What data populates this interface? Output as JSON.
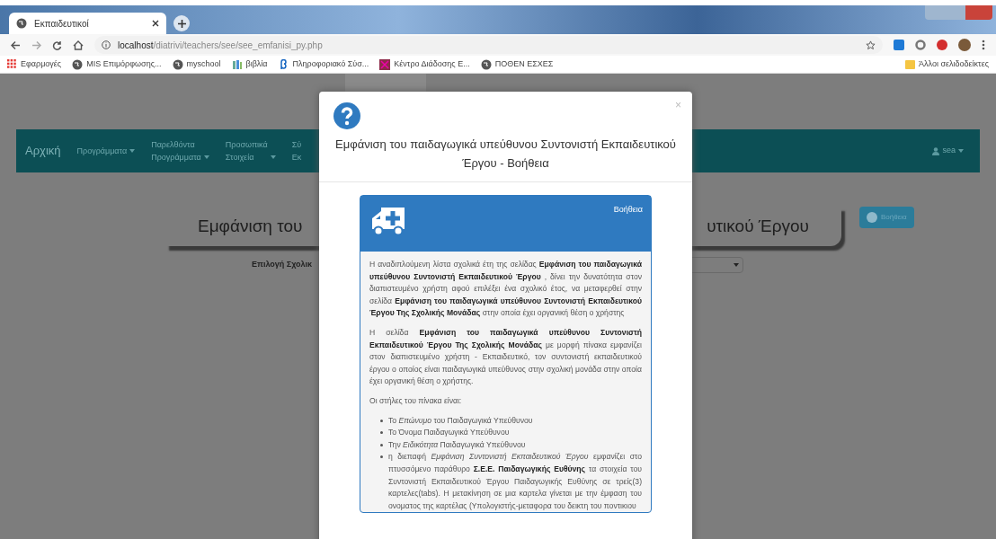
{
  "browser": {
    "tab": {
      "title": "Εκπαιδευτικοί",
      "selected": true
    },
    "url_host": "localhost",
    "url_path": "/diatrivi/teachers/see/see_emfanisi_py.php",
    "bookmarks": [
      {
        "kind": "apps",
        "label": "Εφαρμογές"
      },
      {
        "kind": "globe",
        "label": "MIS Επιμόρφωσης..."
      },
      {
        "kind": "globe",
        "label": "myschool"
      },
      {
        "kind": "books",
        "label": "βιβλία"
      },
      {
        "kind": "beta",
        "label": "Πληροφοριακό Σύσ..."
      },
      {
        "kind": "square",
        "label": "Κέντρο Διάδοσης Ε..."
      },
      {
        "kind": "globe",
        "label": "ΠΟΘΕΝ ΕΣΧΕΣ"
      }
    ],
    "other_bookmarks": "Άλλοι σελιδοδείκτες"
  },
  "navbar": {
    "brand": "Αρχική",
    "menus": [
      {
        "label": "Προγράμματα",
        "dropdown": true
      },
      {
        "label": "Παρελθόντα",
        "second": "Προγράμματα",
        "dropdown": true
      },
      {
        "label": "Προσωπικά",
        "second": "Στοιχεία",
        "dropdown": true
      },
      {
        "label": "Σύ",
        "second": "Εκ",
        "dropdown": false
      }
    ],
    "user": "sea"
  },
  "page": {
    "title_left": "Εμφάνιση του",
    "title_right": "υτικού Έργου",
    "school_year_label": "Επιλογή Σχολικ",
    "help_button": "Βοήθεια"
  },
  "modal": {
    "title": "Εμφάνιση του παιδαγωγικά υπεύθυνου Συντονιστή Εκπαιδευτικού Έργου - Βοήθεια",
    "close": "×",
    "panel": {
      "heading": "Βοήθεια",
      "paragraphs": [
        "Η αναδιπλούμενη λίστα σχολικά έτη της σελίδας **Εμφάνιση του παιδαγωγικά υπεύθυνου Συντονιστή Εκπαιδευτικού Έργου** , δίνει την δυνατότητα στον διαπιστευμένο χρήστη αφού επιλέξει ένα σχολικό έτος, να μεταφερθεί στην σελίδα **Εμφάνιση του παιδαγωγικά υπεύθυνου Συντονιστή Εκπαιδευτικού Έργου Της Σχολικής Μονάδας** στην οποία έχει οργανική θέση ο χρήστης",
        "Η σελίδα **Εμφάνιση του παιδαγωγικά υπεύθυνου Συντονιστή Εκπαιδευτικού Έργου Της Σχολικής Μονάδας** με μορφή πίνακα εμφανίζει στον διαπιστευμένο χρήστη - Εκπαιδευτικό, τον συντονιστή εκπαιδευτικού έργου ο οποίος είναι παιδαγωγικά υπεύθυνος στην σχολική μονάδα στην οποία έχει οργανική θέση ο χρήστης.",
        "Οι στήλες του πίνακα είναι:"
      ],
      "list": [
        "Το *Επώνυμο* του Παιδαγωγικά Υπεύθυνου",
        "Το Όνομα Παιδαγωγικά Υπεύθυνου",
        "Την *Ειδικότητα* Παιδαγωγικά Υπεύθυνου",
        "η διεπαφή *Εμφάνιση Συντονιστή Εκπαιδευτικού Έργου* εμφανίζει στο πτυσσόμενο παράθυρο **Σ.Ε.Ε. Παιδαγωγικής Ευθύνης** τα στοιχεία του Συντονιστή Εκπαιδευτικού Έργου Παιδαγωγικής Ευθύνης σε τρείς(3) καρτελες(tabs). Η μετακίνηση σε μια καρτελα γίνεται με την έμφαση του ονοματος της καρτέλας (Υπολογιστής-μεταφορα του δεικτη του ποντικιου"
      ]
    }
  }
}
